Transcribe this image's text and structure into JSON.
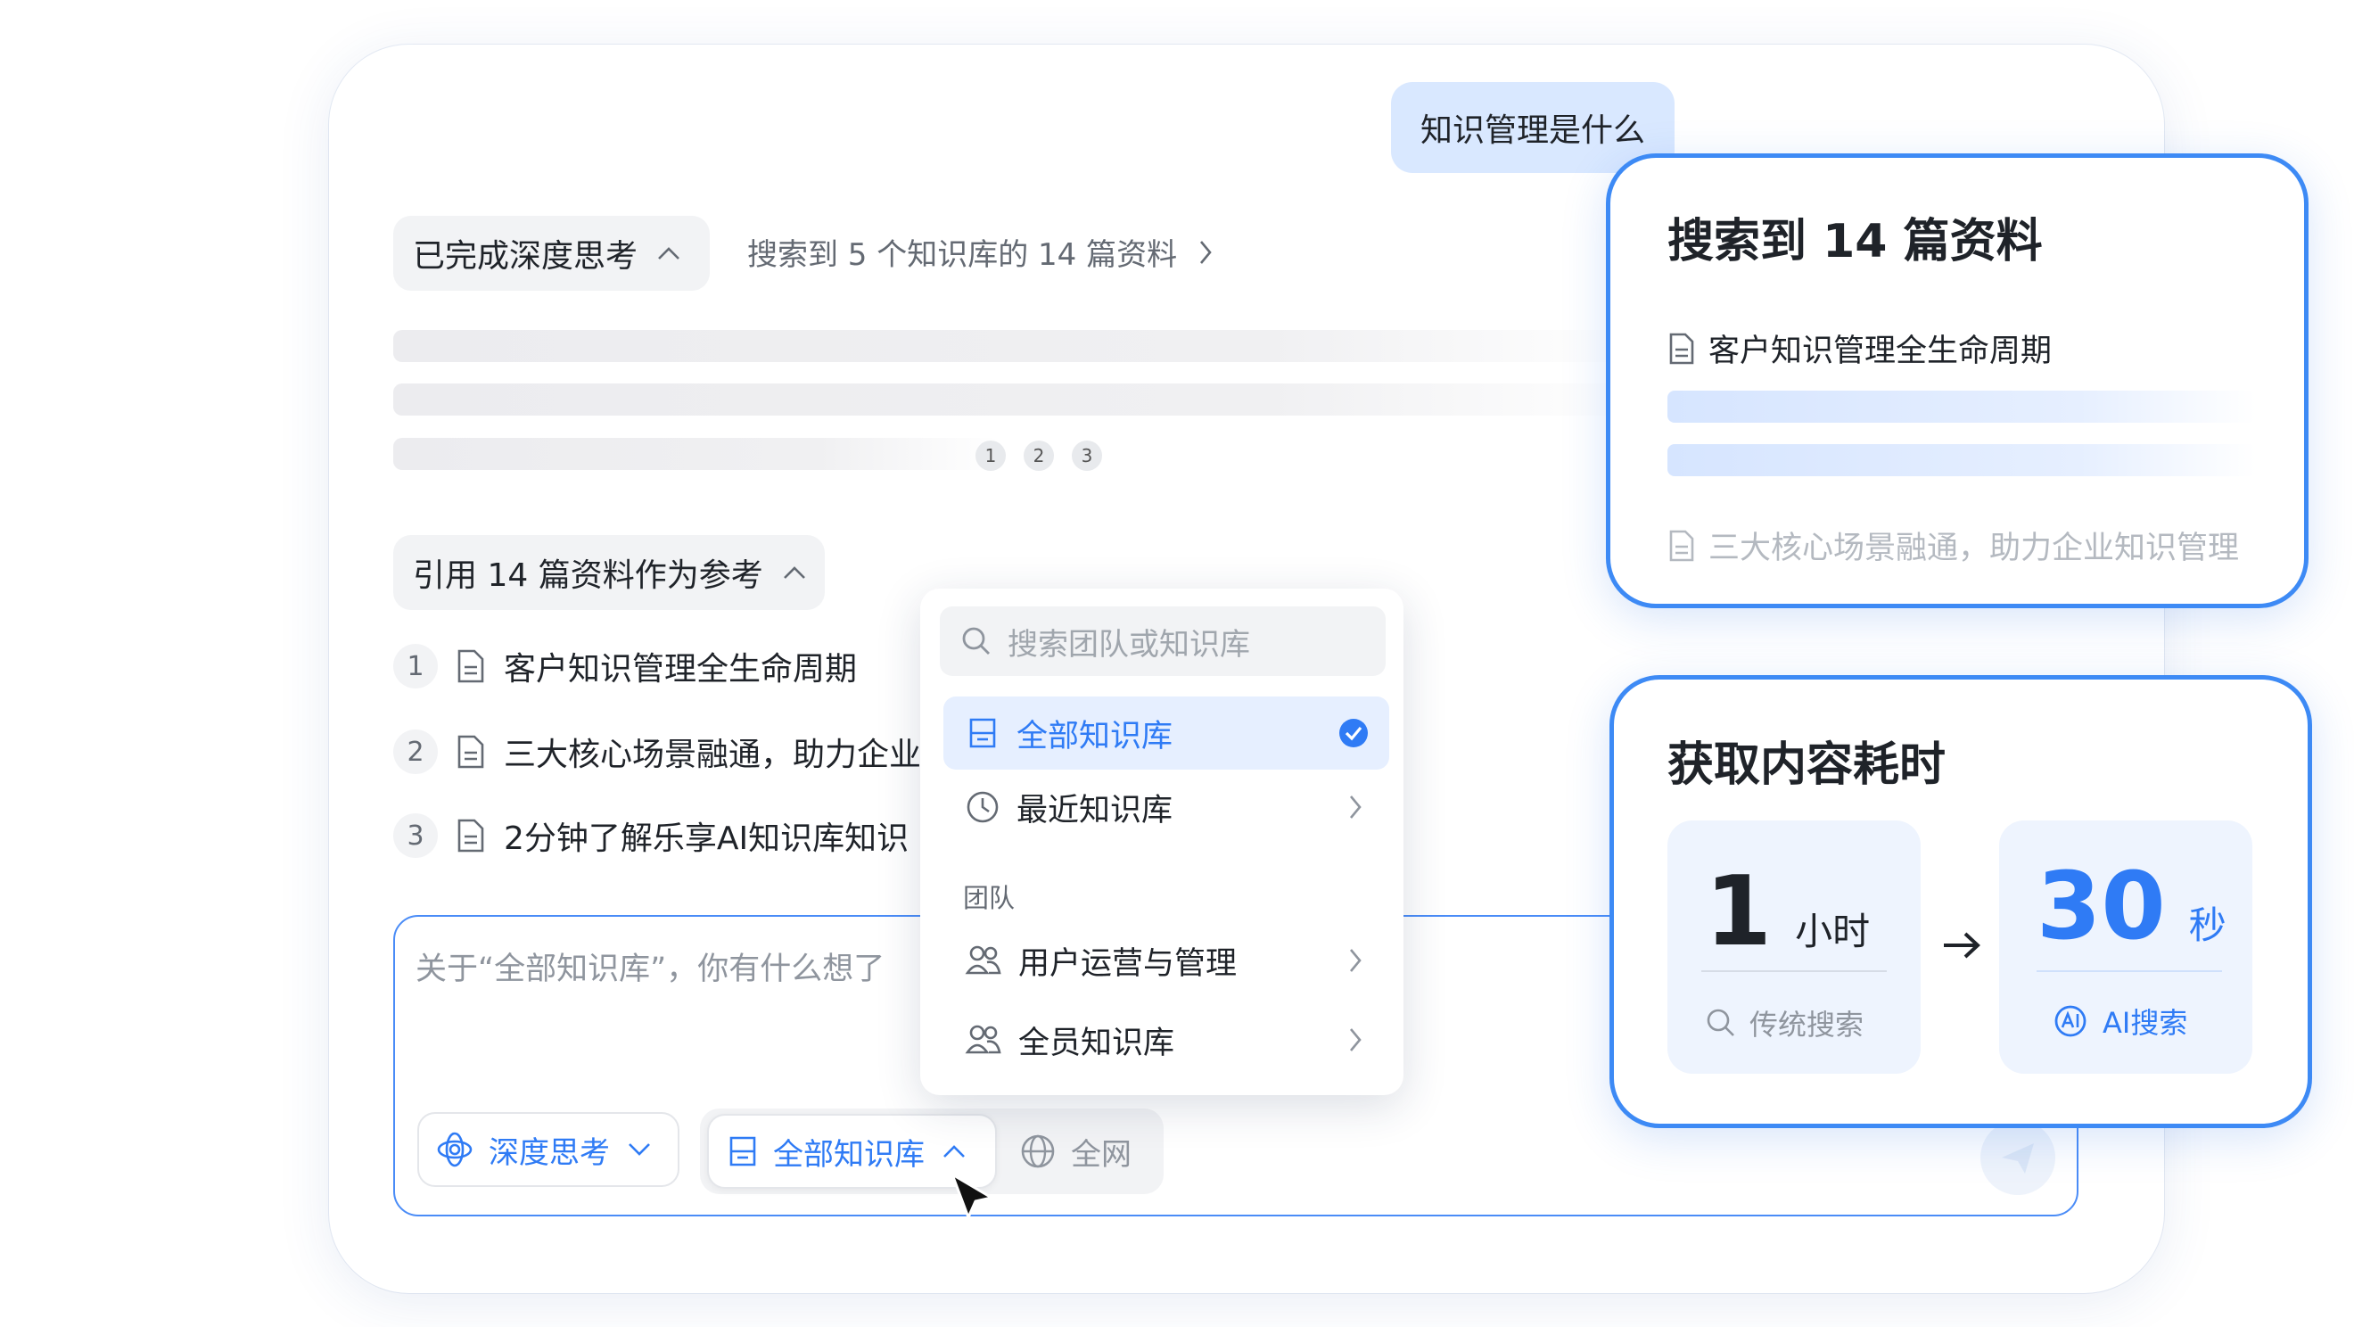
{
  "chat": {
    "user_message": "知识管理是什么",
    "thinking_chip": "已完成深度思考",
    "search_summary": "搜索到 5 个知识库的 14 篇资料",
    "citation_dots": [
      "1",
      "2",
      "3"
    ],
    "references_chip": "引用 14 篇资料作为参考",
    "references": [
      {
        "num": "1",
        "title": "客户知识管理全生命周期"
      },
      {
        "num": "2",
        "title": "三大核心场景融通，助力企业"
      },
      {
        "num": "3",
        "title": "2分钟了解乐享AI知识库知识"
      }
    ]
  },
  "composer": {
    "placeholder": "关于“全部知识库”，你有什么想了",
    "deep_think_label": "深度思考",
    "kb_label": "全部知识库",
    "web_label": "全网"
  },
  "dropdown": {
    "search_placeholder": "搜索团队或知识库",
    "all_kb": "全部知识库",
    "recent_kb": "最近知识库",
    "section_team": "团队",
    "teams": [
      "用户运营与管理",
      "全员知识库"
    ]
  },
  "search_card": {
    "title": "搜索到 14 篇资料",
    "doc1": "客户知识管理全生命周期",
    "doc2": "三大核心场景融通，助力企业知识管理"
  },
  "time_card": {
    "title": "获取内容耗时",
    "traditional_value": "1",
    "traditional_unit": "小时",
    "traditional_label": "传统搜索",
    "ai_value": "30",
    "ai_unit": "秒",
    "ai_label": "AI搜索"
  },
  "colors": {
    "accent": "#2f7bf5",
    "bubble": "#d9e8ff",
    "chip_bg": "#f2f3f5"
  }
}
